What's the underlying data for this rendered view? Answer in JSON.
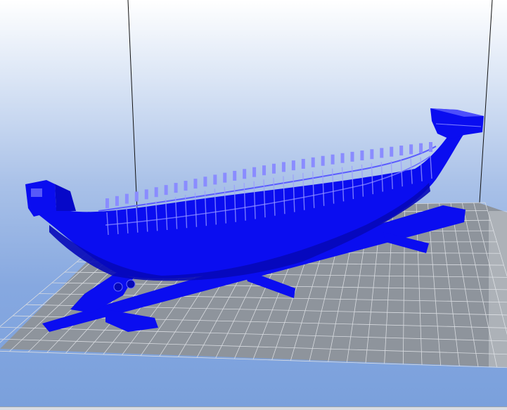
{
  "viewer": {
    "view": "3d-perspective",
    "background_top": "#ffffff",
    "background_bottom": "#7aa0dc",
    "bed_color": "#8e949c",
    "grid_line_color": "#d8dbe0",
    "model_color": "#0a0df0",
    "model_shadow_color": "#0508b8",
    "model_highlight_color": "#8a8cff",
    "frame_line_color": "#111111"
  },
  "model": {
    "icon": "trireme-ship-model",
    "oar_count": 34
  }
}
